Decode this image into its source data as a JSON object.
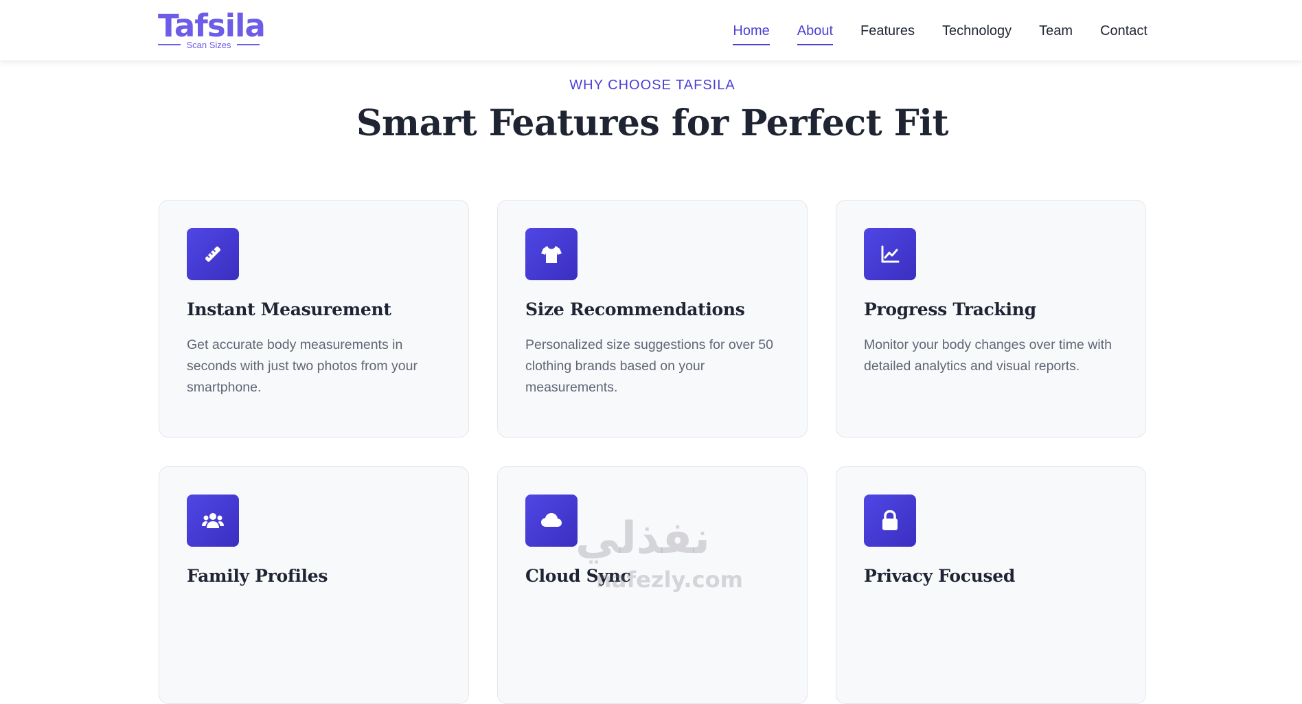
{
  "brand": {
    "name": "Tafsila",
    "tagline": "Scan Sizes",
    "accent": "#4a3fd4",
    "logo_color": "#6c5ce7"
  },
  "nav": {
    "items": [
      {
        "label": "Home",
        "active": true
      },
      {
        "label": "About",
        "active": true
      },
      {
        "label": "Features",
        "active": false
      },
      {
        "label": "Technology",
        "active": false
      },
      {
        "label": "Team",
        "active": false
      },
      {
        "label": "Contact",
        "active": false
      }
    ]
  },
  "section": {
    "eyebrow": "WHY CHOOSE TAFSILA",
    "title": "Smart Features for Perfect Fit"
  },
  "features": [
    {
      "icon": "ruler-icon",
      "title": "Instant Measurement",
      "description": "Get accurate body measurements in seconds with just two photos from your smartphone."
    },
    {
      "icon": "tshirt-icon",
      "title": "Size Recommendations",
      "description": "Personalized size suggestions for over 50 clothing brands based on your measurements."
    },
    {
      "icon": "chart-line-icon",
      "title": "Progress Tracking",
      "description": "Monitor your body changes over time with detailed analytics and visual reports."
    },
    {
      "icon": "users-icon",
      "title": "Family Profiles",
      "description": ""
    },
    {
      "icon": "cloud-icon",
      "title": "Cloud Sync",
      "description": ""
    },
    {
      "icon": "lock-icon",
      "title": "Privacy Focused",
      "description": ""
    }
  ],
  "watermark": {
    "arabic": "نفذلي",
    "latin": "nafezly.com"
  }
}
